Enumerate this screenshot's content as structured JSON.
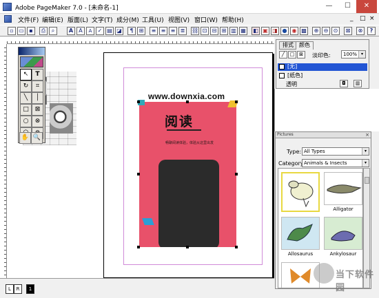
{
  "window": {
    "title": "Adobe PageMaker 7.0 - [未命名-1]",
    "min_label": "—",
    "max_label": "☐",
    "close_label": "✕"
  },
  "menubar": {
    "items": [
      "文件(F)",
      "编辑(E)",
      "版面(L)",
      "文字(T)",
      "成分(M)",
      "工具(U)",
      "视图(V)",
      "窗口(W)",
      "帮助(H)"
    ],
    "restore_labels": [
      "_",
      "□",
      "×"
    ]
  },
  "toolbar": {
    "font_a": "A",
    "font_a_plus": "A",
    "font_a_minus": "A",
    "pilcrow": "¶",
    "help": "?"
  },
  "document": {
    "watermark": "www.downxia.com",
    "poster_title": "阅读",
    "poster_subtitle": "畅聊阅读体验，体验从这里出发"
  },
  "toolbox": {
    "tools": [
      "↖",
      "T",
      "↻",
      "⌗",
      "╲",
      "│",
      "□",
      "⊠",
      "○",
      "⊗",
      "⬡",
      "⊗",
      "✋",
      "🔍"
    ]
  },
  "pagebar": {
    "left_page": "L",
    "right_page": "R",
    "page_number": "1"
  },
  "colors_panel": {
    "tabs": [
      "排式",
      "颜色"
    ],
    "tint_label": "淡印色:",
    "tint_value": "100%",
    "rows": [
      {
        "label": "[无]",
        "selected": true
      },
      {
        "label": "[纸色]",
        "selected": false
      }
    ],
    "footer_label": "透明"
  },
  "pictures_panel": {
    "title": "Pictures",
    "close": "×",
    "type_label": "Type:",
    "type_value": "All Types",
    "category_label": "Category:",
    "category_value": "Animals & Insects",
    "thumbnails": [
      "",
      "Alligator",
      "Allosaurus",
      "Ankylosaur"
    ]
  },
  "site_logo": {
    "text": "当下软件园"
  },
  "colors": {
    "accent": "#2255d4",
    "poster": "#e8516a",
    "close": "#c9473d"
  }
}
